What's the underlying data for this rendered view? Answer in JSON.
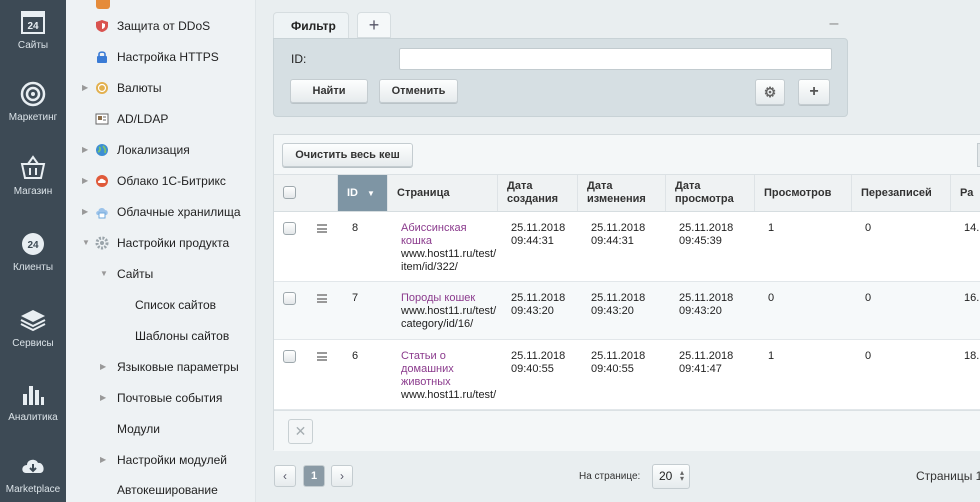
{
  "rail": [
    {
      "label": "Сайты",
      "icon": "calendar-24-icon"
    },
    {
      "label": "Маркетинг",
      "icon": "target-icon"
    },
    {
      "label": "Магазин",
      "icon": "basket-icon"
    },
    {
      "label": "Клиенты",
      "icon": "clients-24-icon"
    },
    {
      "label": "Сервисы",
      "icon": "layers-icon"
    },
    {
      "label": "Аналитика",
      "icon": "bar-chart-icon"
    },
    {
      "label": "Marketplace",
      "icon": "cloud-download-icon"
    }
  ],
  "tree": [
    {
      "label": "Защита от DDoS",
      "icon": "shield-icon",
      "color": "#d9534f",
      "arrow": "",
      "icon_shown": true
    },
    {
      "label": "Настройка HTTPS",
      "icon": "lock-icon",
      "color": "#3a7bd5",
      "arrow": "",
      "icon_shown": true
    },
    {
      "label": "Валюты",
      "icon": "currency-icon",
      "color": "#d4a04a",
      "arrow": "▶",
      "icon_shown": true
    },
    {
      "label": "AD/LDAP",
      "icon": "ldap-icon",
      "color": "#8a6d4a",
      "arrow": "",
      "icon_shown": true
    },
    {
      "label": "Локализация",
      "icon": "globe-icon",
      "color": "#3d8ed4",
      "arrow": "▶",
      "icon_shown": true
    },
    {
      "label": "Облако 1С-Битрикс",
      "icon": "cloud-icon",
      "color": "#e05a3a",
      "arrow": "▶",
      "icon_shown": true
    },
    {
      "label": "Облачные хранилища",
      "icon": "storage-icon",
      "color": "#6fa8dc",
      "arrow": "▶",
      "icon_shown": true
    },
    {
      "label": "Настройки продукта",
      "icon": "gear-icon",
      "color": "#9aa4aa",
      "arrow": "▼",
      "icon_shown": true
    },
    {
      "label": "Сайты",
      "arrow": "▼",
      "icon_shown": false
    },
    {
      "label": "Список сайтов",
      "arrow": "",
      "icon_shown": false
    },
    {
      "label": "Шаблоны сайтов",
      "arrow": "",
      "icon_shown": false
    },
    {
      "label": "Языковые параметры",
      "arrow": "▶",
      "icon_shown": false
    },
    {
      "label": "Почтовые события",
      "arrow": "▶",
      "icon_shown": false
    },
    {
      "label": "Модули",
      "arrow": "",
      "icon_shown": false
    },
    {
      "label": "Настройки модулей",
      "arrow": "▶",
      "icon_shown": false
    },
    {
      "label": "Автокеширование",
      "arrow": "",
      "icon_shown": false
    }
  ],
  "filter": {
    "tab_label": "Фильтр",
    "add_tab": "+",
    "minimize": "–",
    "id_label": "ID:",
    "id_value": "",
    "find_label": "Найти",
    "cancel_label": "Отменить",
    "gear": "⚙",
    "plus": "+"
  },
  "grid": {
    "clear_cache_label": "Очистить весь кеш",
    "columns": {
      "id": "ID",
      "sort": "▼",
      "page": "Страница",
      "created": "Дата создания",
      "modified": "Дата изменения",
      "viewed": "Дата просмотра",
      "views": "Просмотров",
      "rewrites": "Перезаписей",
      "last": "Ра"
    },
    "rows": [
      {
        "id": "8",
        "title": "Абиссинская кошка",
        "url": "www.host11.ru/test/item/id/322/",
        "created": "25.11.2018 09:44:31",
        "modified": "25.11.2018 09:44:31",
        "viewed": "25.11.2018 09:45:39",
        "views": "1",
        "rewrites": "0",
        "last": "14."
      },
      {
        "id": "7",
        "title": "Породы кошек",
        "url": "www.host11.ru/test/category/id/16/",
        "created": "25.11.2018 09:43:20",
        "modified": "25.11.2018 09:43:20",
        "viewed": "25.11.2018 09:43:20",
        "views": "0",
        "rewrites": "0",
        "last": "16."
      },
      {
        "id": "6",
        "title": "Статьи о домашних животных",
        "url": "www.host11.ru/test/",
        "created": "25.11.2018 09:40:55",
        "modified": "25.11.2018 09:40:55",
        "viewed": "25.11.2018 09:41:47",
        "views": "1",
        "rewrites": "0",
        "last": "18."
      }
    ],
    "delete_symbol": "✕"
  },
  "pager": {
    "prev": "‹",
    "current": "1",
    "next": "›",
    "per_page_label": "На странице:",
    "per_page_value": "20",
    "pages_label": "Страницы 1"
  },
  "colors": {
    "rail_bg": "#3d4a55",
    "link": "#8b3b8d",
    "id_header": "#7e95a4"
  }
}
